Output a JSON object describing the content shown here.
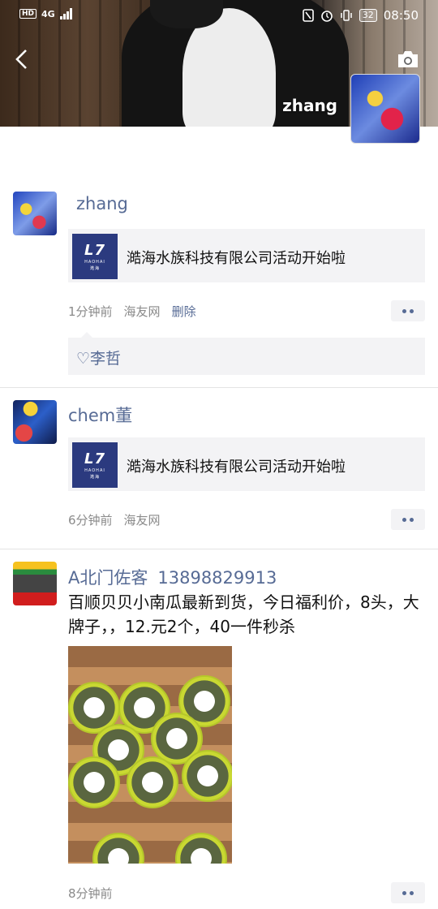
{
  "status": {
    "left": {
      "hd": "HD",
      "network": "4G"
    },
    "battery": "32",
    "time": "08:50"
  },
  "header": {
    "profile_name": "zhang"
  },
  "posts": [
    {
      "name": "zhang",
      "share_title": "澔海水族科技有限公司活动开始啦",
      "share_logo_text": "HAOHAI",
      "share_logo_sub": "澔海",
      "time": "1分钟前",
      "source": "海友网",
      "delete_label": "删除",
      "likes": "♡李哲"
    },
    {
      "name": "chem董",
      "share_title": "澔海水族科技有限公司活动开始啦",
      "share_logo_text": "HAOHAI",
      "share_logo_sub": "澔海",
      "time": "6分钟前",
      "source": "海友网"
    },
    {
      "name": "A北门佐客",
      "phone": "13898829913",
      "text": "百顺贝贝小南瓜最新到货，今日福利价，8头，大牌子，，12.元2个，40一件秒杀",
      "time": "8分钟前"
    }
  ]
}
